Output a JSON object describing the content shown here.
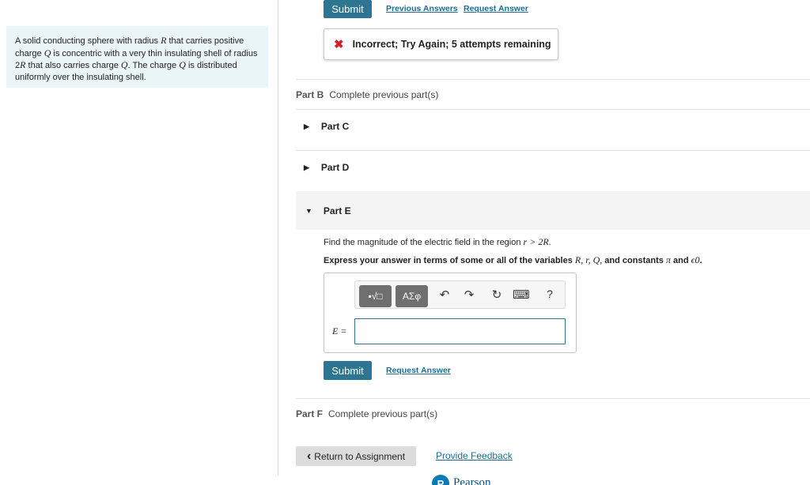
{
  "problem": {
    "t1": "A solid conducting sphere with radius ",
    "m1": "R",
    "t2": " that carries positive charge ",
    "m2": "Q",
    "t3": " is concentric with a very thin insulating shell of radius 2",
    "m3": "R",
    "t4": " that also carries charge ",
    "m4": "Q",
    "t5": ". The charge ",
    "m5": "Q",
    "t6": " is distributed uniformly over the insulating shell."
  },
  "partA": {
    "submit_label": "Submit",
    "previous_answers": "Previous Answers",
    "request_answer": "Request Answer",
    "feedback_icon": "✖",
    "feedback": "Incorrect; Try Again; 5 attempts remaining"
  },
  "partB": {
    "label": "Part B",
    "status": "Complete previous part(s)"
  },
  "partC": {
    "label": "Part C",
    "icon": "triangle-right-icon"
  },
  "partD": {
    "label": "Part D",
    "icon": "triangle-right-icon"
  },
  "partE": {
    "label": "Part E",
    "icon": "triangle-down-icon",
    "question_text": "Find the magnitude of the electric field in the region ",
    "question_math": "r > 2R",
    "question_end": ".",
    "instructions_text": "Express your answer in terms of some or all of the variables ",
    "instructions_vars": "R, r, Q,",
    "instructions_mid": " and constants ",
    "instructions_pi": "π",
    "instructions_and": " and ",
    "instructions_eps": "ϵ0",
    "instructions_end": ".",
    "toolbar_templates": "▪√□",
    "toolbar_greek": "AΣφ",
    "toolbar_help": "?",
    "answer_label": "E =",
    "answer_value": "",
    "submit_label": "Submit",
    "request_answer": "Request Answer"
  },
  "partF": {
    "label": "Part F",
    "status": "Complete previous part(s)"
  },
  "footer": {
    "return_label": "Return to Assignment",
    "return_icon": "‹",
    "feedback_link": "Provide Feedback",
    "brand": "Pearson",
    "brand_mark": "P"
  },
  "colors": {
    "primary": "#2e7592",
    "link": "#1d6d92",
    "error": "#d0212a",
    "panel": "#e9f5f6"
  }
}
